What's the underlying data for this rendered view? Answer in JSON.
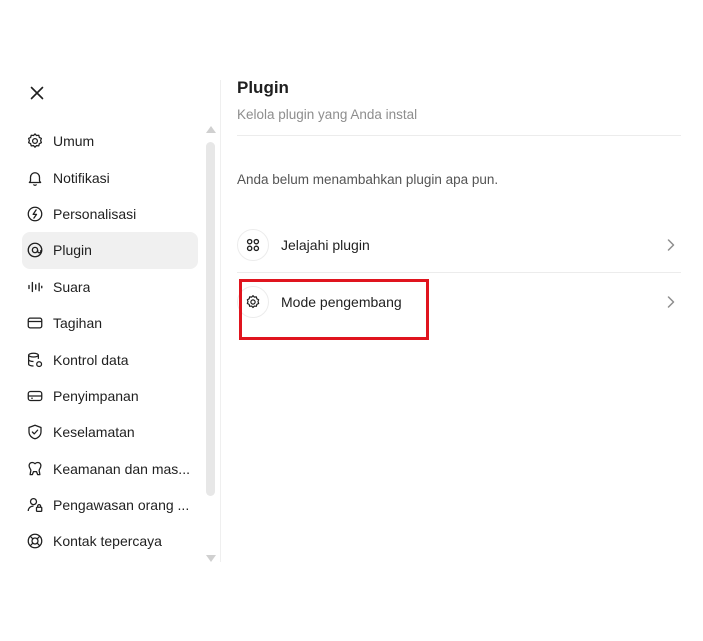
{
  "sidebar": {
    "items": [
      {
        "label": "Umum",
        "icon": "gear-icon"
      },
      {
        "label": "Notifikasi",
        "icon": "bell-icon"
      },
      {
        "label": "Personalisasi",
        "icon": "personalize-icon"
      },
      {
        "label": "Plugin",
        "icon": "plugin-icon",
        "active": true
      },
      {
        "label": "Suara",
        "icon": "waveform-icon"
      },
      {
        "label": "Tagihan",
        "icon": "card-icon"
      },
      {
        "label": "Kontrol data",
        "icon": "database-gear-icon"
      },
      {
        "label": "Penyimpanan",
        "icon": "storage-icon"
      },
      {
        "label": "Keselamatan",
        "icon": "shield-check-icon"
      },
      {
        "label": "Keamanan dan mas...",
        "icon": "security-icon"
      },
      {
        "label": "Pengawasan orang ...",
        "icon": "person-lock-icon"
      },
      {
        "label": "Kontak tepercaya",
        "icon": "lifebuoy-icon"
      }
    ]
  },
  "main": {
    "title": "Plugin",
    "subtitle": "Kelola plugin yang Anda instal",
    "empty_text": "Anda belum menambahkan plugin apa pun.",
    "rows": [
      {
        "label": "Jelajahi plugin",
        "icon": "grid-circles-icon"
      },
      {
        "label": "Mode pengembang",
        "icon": "gear-icon"
      }
    ]
  },
  "colors": {
    "highlight": "#e0141e",
    "active_bg": "#f0f0f0"
  }
}
